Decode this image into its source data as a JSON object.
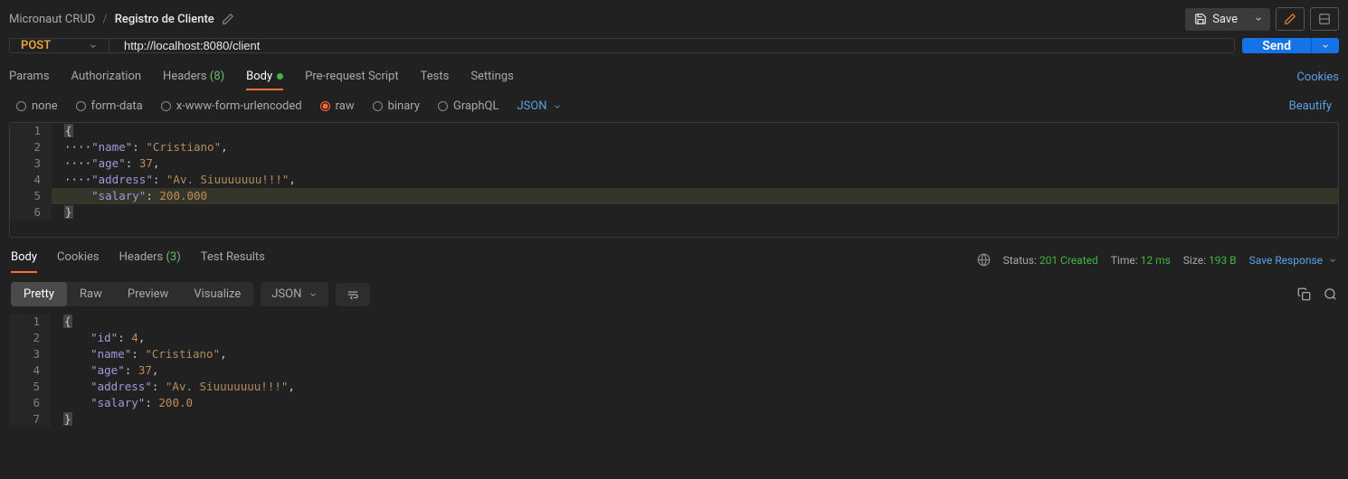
{
  "breadcrumb": {
    "parent": "Micronaut CRUD",
    "current": "Registro de Cliente"
  },
  "topbar": {
    "save": "Save"
  },
  "request": {
    "method": "POST",
    "url": "http://localhost:8080/client",
    "send": "Send"
  },
  "reqTabs": {
    "params": "Params",
    "auth": "Authorization",
    "headers": "Headers",
    "headersCount": "(8)",
    "body": "Body",
    "preReq": "Pre-request Script",
    "tests": "Tests",
    "settings": "Settings",
    "cookies": "Cookies"
  },
  "bodyTypes": {
    "none": "none",
    "formData": "form-data",
    "xwww": "x-www-form-urlencoded",
    "raw": "raw",
    "binary": "binary",
    "graphql": "GraphQL",
    "json": "JSON",
    "beautify": "Beautify"
  },
  "reqBody": {
    "name_k": "\"name\"",
    "name_v": "\"Cristiano\"",
    "age_k": "\"age\"",
    "age_v": "37",
    "addr_k": "\"address\"",
    "addr_v": "\"Av. Siuuuuuuu!!!\"",
    "sal_k": "\"salary\"",
    "sal_v": "200.000"
  },
  "respTabs": {
    "body": "Body",
    "cookies": "Cookies",
    "headers": "Headers",
    "headersCount": "(3)",
    "testResults": "Test Results"
  },
  "respMeta": {
    "statusLabel": "Status:",
    "status": "201 Created",
    "timeLabel": "Time:",
    "time": "12 ms",
    "sizeLabel": "Size:",
    "size": "193 B",
    "saveResp": "Save Response"
  },
  "respView": {
    "pretty": "Pretty",
    "raw": "Raw",
    "preview": "Preview",
    "visualize": "Visualize",
    "json": "JSON"
  },
  "respBody": {
    "id_k": "\"id\"",
    "id_v": "4",
    "name_k": "\"name\"",
    "name_v": "\"Cristiano\"",
    "age_k": "\"age\"",
    "age_v": "37",
    "addr_k": "\"address\"",
    "addr_v": "\"Av. Siuuuuuuu!!!\"",
    "sal_k": "\"salary\"",
    "sal_v": "200.0"
  }
}
